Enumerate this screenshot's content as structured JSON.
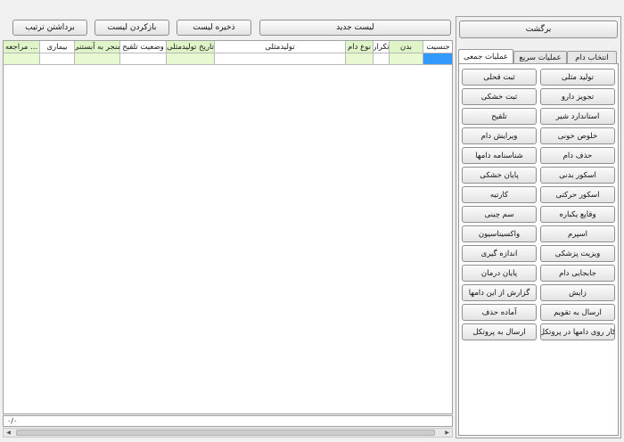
{
  "toolbar": {
    "new_list": "لیست جدید",
    "save_list": "ذخیره لیست",
    "load_list": "بازکردن لیست",
    "remove_order": "برداشتن ترتیب"
  },
  "grid": {
    "columns": [
      "جنسیت",
      "بدن",
      "تکرار",
      "نوع دام",
      "تولیدمثلی",
      "تاریخ تولیدمثلی",
      "وضعیت تلقیح",
      "منجر به آبستنی",
      "بیماری",
      "مراجعه ..."
    ]
  },
  "status": {
    "text": "۰/۰"
  },
  "right_panel": {
    "back": "برگشت",
    "tabs": [
      "انتخاب دام",
      "عملیات سریع",
      "عملیات جمعی"
    ],
    "ops": [
      "تولید مثلی",
      "ثبت قحلی",
      "تجویز دارو",
      "ثبت خشکی",
      "استاندارد شیر",
      "تلقیح",
      "خلوص خونی",
      "ویرایش دام",
      "حذف دام",
      "شناسنامه دامها",
      "اسکور بدنی",
      "پایان خشکی",
      "اسکور حرکتی",
      "کارتیه",
      "وقایع یکباره",
      "سم چینی",
      "اسپرم",
      "واکسیناسیون",
      "ویزیت پزشکی",
      "اندازه گیری",
      "جابجایی دام",
      "پایان درمان",
      "زایش",
      "گزارش از این دامها",
      "ارسال به تقویم",
      "آماده حذف",
      "کار روی دامها در پروتکل",
      "ارسال به پروتکل"
    ]
  }
}
